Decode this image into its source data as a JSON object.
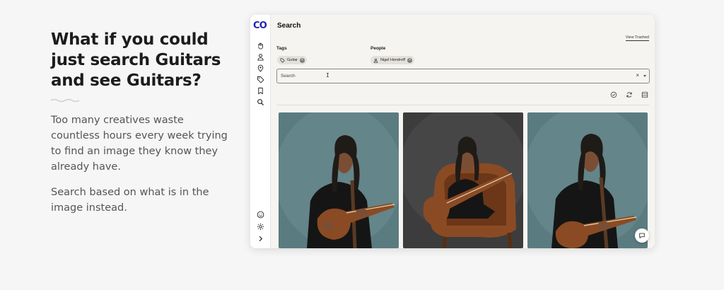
{
  "hero": {
    "headline": "What if you could just search Guitars and see Guitars?",
    "paragraph_1": "Too many creatives waste countless hours every week trying to find an image they know they already have.",
    "paragraph_2": "Search based on what is in the image instead."
  },
  "app": {
    "logo_text": "CO",
    "page_title": "Search",
    "view_trashed_label": "View Trashed",
    "filters": {
      "tags_label": "Tags",
      "people_label": "People",
      "tag_chip": "Guitar",
      "person_chip": "Nigel Hendroff"
    },
    "search": {
      "placeholder": "Search",
      "value": ""
    },
    "sidebar_icons": [
      "hand-icon",
      "user-icon",
      "location-pin-icon",
      "tag-icon",
      "bookmark-icon",
      "search-icon",
      "emoji-icon",
      "settings-icon",
      "chevron-right-icon"
    ],
    "toolbar_icons": [
      "check-circle-icon",
      "refresh-icon",
      "layout-icon"
    ],
    "colors": {
      "brand": "#1e22b8",
      "backdrop_teal": "#5a7c80",
      "backdrop_dark": "#3c3c3c",
      "chair_brown": "#8a4b24"
    }
  }
}
